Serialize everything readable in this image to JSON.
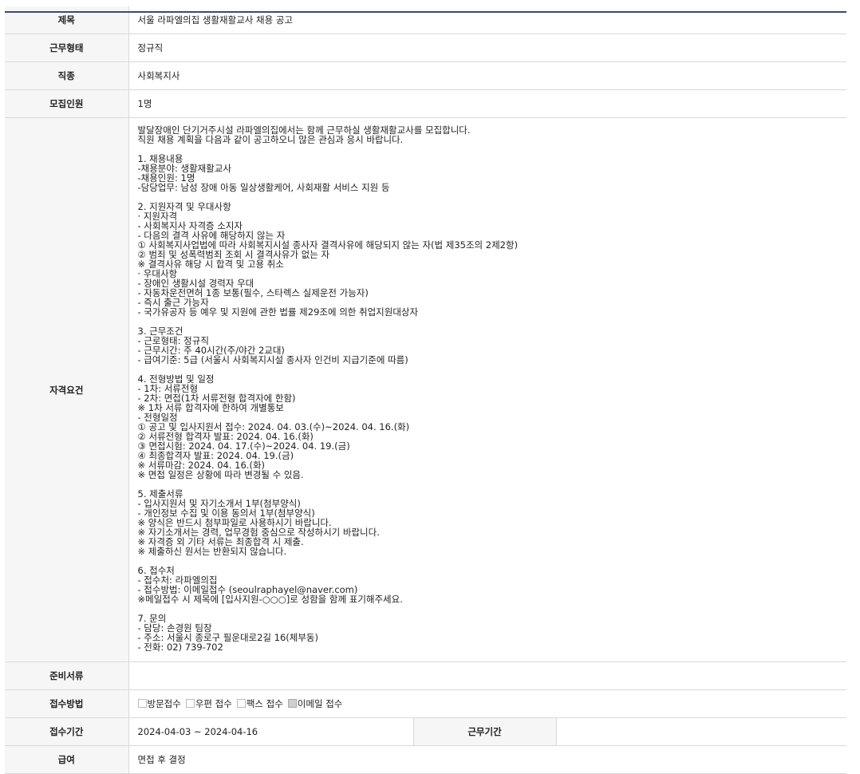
{
  "rows": {
    "title": {
      "label": "제목",
      "value": "서울 라파엘의집 생활재활교사 채용 공고"
    },
    "employment_type": {
      "label": "근무형태",
      "value": "정규직"
    },
    "job_type": {
      "label": "직종",
      "value": "사회복지사"
    },
    "headcount": {
      "label": "모집인원",
      "value": "1명"
    },
    "qualifications": {
      "label": "자격요건",
      "lines": [
        "발달장애인 단기거주시설 라파엘의집에서는 함께 근무하실 생활재활교사를 모집합니다.",
        "직원 채용 계획을 다음과 같이 공고하오니 많은 관심과 응시 바랍니다.",
        "",
        "1. 채용내용",
        "-채용분야: 생활재활교사",
        "-채용인원: 1명",
        "-담당업무: 남성 장애 아동 일상생활케어, 사회재활 서비스 지원 등",
        "",
        "2. 지원자격 및 우대사항",
        "· 지원자격",
        "- 사회복지사 자격증 소지자",
        "- 다음의 결격 사유에 해당하지 않는 자",
        "① 사회복지사업법에 따라 사회복지시설 종사자 결격사유에 해당되지 않는 자(법 제35조의 2제2항)",
        "② 범죄 및 성폭력범죄 조회 시 결격사유가 없는 자",
        "※ 결격사유 해당 시 합격 및 고용 취소",
        "· 우대사항",
        "- 장애인 생활시설 경력자 우대",
        "- 자동차운전면허 1종 보통(필수, 스타렉스 실제운전 가능자)",
        "- 즉시 출근 가능자",
        "- 국가유공자 등 예우 및 지원에 관한 법률 제29조에 의한 취업지원대상자",
        "",
        "3. 근무조건",
        "- 근로형태: 정규직",
        "- 근무시간: 주 40시간(주/야간 2교대)",
        "- 급여기준: 5급 (서울시 사회복지시설 종사자 인건비 지급기준에 따름)",
        "",
        "4. 전형방법 및 일정",
        "- 1차: 서류전형",
        "- 2차: 면접(1차 서류전형 합격자에 한함)",
        "※ 1차 서류 합격자에 한하여 개별통보",
        "- 전형일정",
        "① 공고 및 입사지원서 접수: 2024. 04. 03.(수)~2024. 04. 16.(화)",
        "② 서류전형 합격자 발표: 2024. 04. 16.(화)",
        "③ 면접시험: 2024. 04. 17.(수)~2024. 04. 19.(금)",
        "④ 최종합격자 발표: 2024. 04. 19.(금)",
        "※ 서류마감: 2024. 04. 16.(화)",
        "※ 면접 일정은 상황에 따라 변경될 수 있음.",
        "",
        "5. 제출서류",
        "- 입사지원서 및 자기소개서 1부(첨부양식)",
        "- 개인정보 수집 및 이용 동의서 1부(첨부양식)",
        "※ 양식은 반드시 첨부파일로 사용하시기 바랍니다.",
        "※ 자기소개서는 경력, 업무경험 중심으로 작성하시기 바랍니다.",
        "※ 자격증 외 기타 서류는 최종합격 시 제출.",
        "※ 제출하신 원서는 반환되지 않습니다.",
        "",
        "6. 접수처",
        "- 접수처: 라파엘의집",
        "- 접수방법: 이메일접수 (seoulraphayel@naver.com)",
        "※메일접수 시 제목에 [입사지원-○○○]로 성함을 함께 표기해주세요.",
        "",
        "7. 문의",
        "- 담당: 손경원 팀장",
        "- 주소: 서울시 종로구 필운대로2길 16(체부동)",
        "- 전화: 02) 739-702"
      ]
    },
    "documents": {
      "label": "준비서류",
      "value": ""
    },
    "apply_method": {
      "label": "접수방법",
      "options": [
        {
          "label": "방문접수",
          "checked": false
        },
        {
          "label": "우편 접수",
          "checked": false
        },
        {
          "label": "팩스 접수",
          "checked": false
        },
        {
          "label": "이메일 접수",
          "checked": true
        }
      ]
    },
    "apply_period": {
      "label": "접수기간",
      "value": "2024-04-03 ~ 2024-04-16",
      "work_period_label": "근무기간",
      "work_period_value": ""
    },
    "salary": {
      "label": "급여",
      "value": "면접 후 결정"
    }
  },
  "colors": {
    "header_bg": "#f6f6f6",
    "top_border": "#3b4b6b",
    "border": "#d9d9d9"
  }
}
